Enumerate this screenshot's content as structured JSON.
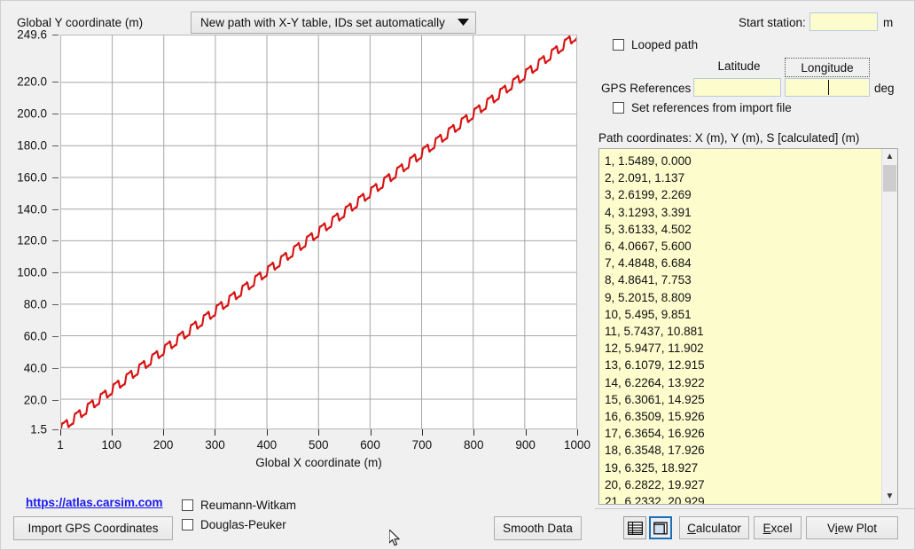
{
  "plot": {
    "y_axis_title": "Global Y coordinate (m)",
    "x_axis_title": "Global X coordinate (m)"
  },
  "path_type_combo": {
    "value": "New path with X-Y table, IDs set automatically",
    "arrow": "chevron-down-icon"
  },
  "right": {
    "start_station_label": "Start station:",
    "start_station_value": "",
    "start_station_unit": "m",
    "looped_path_label": "Looped path",
    "looped_path_checked": false,
    "latitude_header": "Latitude",
    "longitude_header": "Longitude",
    "gps_references_label": "GPS References",
    "latitude_value": "",
    "longitude_value": "",
    "deg_unit": "deg",
    "set_references_label": "Set references from import file",
    "set_references_checked": false,
    "coords_label": "Path coordinates: X (m), Y (m), S [calculated] (m)"
  },
  "coordinates": [
    "1, 1.5489, 0.000",
    "2, 2.091, 1.137",
    "3, 2.6199, 2.269",
    "4, 3.1293, 3.391",
    "5, 3.6133, 4.502",
    "6, 4.0667, 5.600",
    "7, 4.4848, 6.684",
    "8, 4.8641, 7.753",
    "9, 5.2015, 8.809",
    "10, 5.495, 9.851",
    "11, 5.7437, 10.881",
    "12, 5.9477, 11.902",
    "13, 6.1079, 12.915",
    "14, 6.2264, 13.922",
    "15, 6.3061, 14.925",
    "16, 6.3509, 15.926",
    "17, 6.3654, 16.926",
    "18, 6.3548, 17.926",
    "19, 6.325, 18.927",
    "20, 6.2822, 19.927",
    "21, 6.2332, 20.929"
  ],
  "bottom": {
    "atlas_link": "https://atlas.carsim.com",
    "import_gps_label": "Import GPS Coordinates",
    "reumann_witkam_label": "Reumann-Witkam",
    "reumann_witkam_checked": false,
    "douglas_peuker_label": "Douglas-Peuker",
    "douglas_peuker_checked": false,
    "smooth_data_label": "Smooth Data",
    "table_icon": "table-grid-icon",
    "panel_icon": "window-panel-icon",
    "calculator_label": "Calculator",
    "excel_label": "Excel",
    "view_plot_label": "View Plot"
  },
  "chart_data": {
    "type": "line",
    "title": "",
    "xlabel": "Global X coordinate (m)",
    "ylabel": "Global Y coordinate (m)",
    "xlim": [
      1,
      1000
    ],
    "ylim": [
      1.5,
      249.6
    ],
    "xticks": [
      1,
      100,
      200,
      300,
      400,
      500,
      600,
      700,
      800,
      900,
      1000
    ],
    "yticks": [
      1.5,
      20.0,
      40.0,
      60.0,
      80.0,
      100.0,
      120.0,
      140.0,
      160.0,
      180.0,
      200.0,
      220.0,
      249.6
    ],
    "grid": true,
    "legend": "none",
    "series": [
      {
        "name": "path",
        "color": "#d81111",
        "description": "Monotonically increasing near-linear path from (1, 1.5) to (1000, 249.6) with a regular stair-step ripple of about 25 m period in X and about 3 m amplitude in Y.",
        "trend_slope": 0.2484,
        "trend_intercept": 1.2516,
        "ripple_period_x": 25,
        "ripple_amplitude_y": 3.1,
        "x": [
          1,
          50,
          100,
          150,
          200,
          250,
          300,
          350,
          400,
          450,
          500,
          550,
          600,
          650,
          700,
          750,
          800,
          850,
          900,
          950,
          1000
        ],
        "y": [
          1.5,
          13.7,
          26.1,
          38.5,
          50.9,
          63.3,
          75.7,
          88.1,
          100.5,
          112.9,
          125.3,
          137.7,
          150.0,
          162.4,
          174.8,
          187.2,
          199.6,
          212.0,
          224.4,
          236.8,
          249.6
        ]
      }
    ]
  }
}
